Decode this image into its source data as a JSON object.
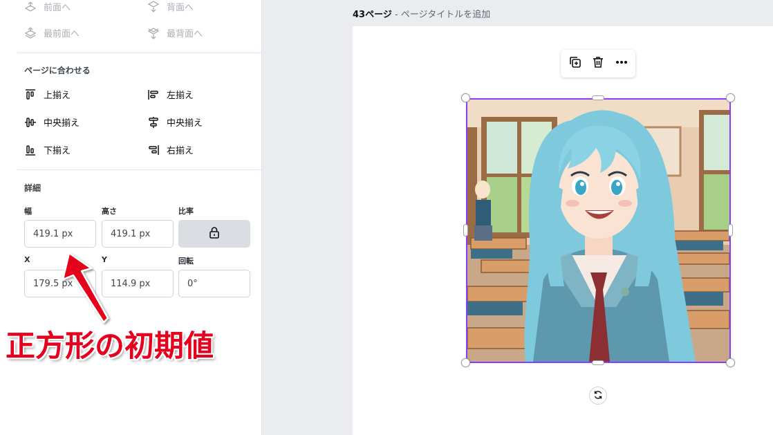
{
  "arrange": {
    "forward": "前面へ",
    "backward": "背面へ",
    "to_front": "最前面へ",
    "to_back": "最背面へ"
  },
  "align": {
    "title": "ページに合わせる",
    "top": "上揃え",
    "left": "左揃え",
    "middle": "中央揃え",
    "center": "中央揃え",
    "bottom": "下揃え",
    "right": "右揃え"
  },
  "details": {
    "title": "詳細",
    "width_label": "幅",
    "height_label": "高さ",
    "ratio_label": "比率",
    "width": "419.1 px",
    "height": "419.1 px",
    "x_label": "X",
    "y_label": "Y",
    "rotation_label": "回転",
    "x": "179.5 px",
    "y": "114.9 px",
    "rotation": "0°"
  },
  "annotation": {
    "text": "正方形の初期値",
    "color": "#e5001e"
  },
  "canvas": {
    "page_number": "43ページ",
    "page_title_placeholder": " - ページタイトルを追加",
    "selection_color": "#8b3dff"
  },
  "icons": {
    "duplicate": "duplicate-icon",
    "delete": "trash-icon",
    "more": "more-icon",
    "rotate": "rotate-icon",
    "lock": "lock-icon"
  }
}
